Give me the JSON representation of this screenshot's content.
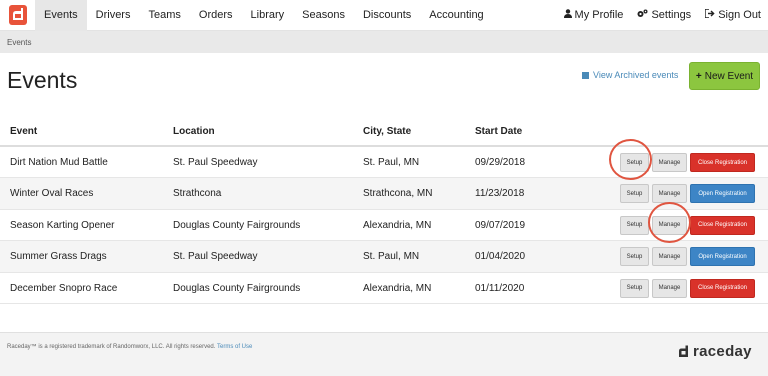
{
  "nav": {
    "items": [
      {
        "label": "Events",
        "active": true
      },
      {
        "label": "Drivers",
        "active": false
      },
      {
        "label": "Teams",
        "active": false
      },
      {
        "label": "Orders",
        "active": false
      },
      {
        "label": "Library",
        "active": false
      },
      {
        "label": "Seasons",
        "active": false
      },
      {
        "label": "Discounts",
        "active": false
      },
      {
        "label": "Accounting",
        "active": false
      }
    ],
    "right": [
      {
        "label": "My Profile",
        "icon": "user-icon"
      },
      {
        "label": "Settings",
        "icon": "gear-icon"
      },
      {
        "label": "Sign Out",
        "icon": "sign-out-icon"
      }
    ]
  },
  "breadcrumb": "Events",
  "page": {
    "title": "Events",
    "archived_link": "View Archived events",
    "new_event_label": "New Event"
  },
  "table": {
    "headers": [
      "Event",
      "Location",
      "City, State",
      "Start Date"
    ],
    "rows": [
      {
        "event": "Dirt Nation Mud Battle",
        "location": "St. Paul Speedway",
        "city": "St. Paul, MN",
        "date": "09/29/2018",
        "setup": "Setup",
        "manage": "Manage",
        "registration": "Close Registration",
        "reg_state": "close"
      },
      {
        "event": "Winter Oval Races",
        "location": "Strathcona",
        "city": "Strathcona, MN",
        "date": "11/23/2018",
        "setup": "Setup",
        "manage": "Manage",
        "registration": "Open Registration",
        "reg_state": "open"
      },
      {
        "event": "Season Karting Opener",
        "location": "Douglas County Fairgrounds",
        "city": "Alexandria, MN",
        "date": "09/07/2019",
        "setup": "Setup",
        "manage": "Manage",
        "registration": "Close Registration",
        "reg_state": "close"
      },
      {
        "event": "Summer Grass Drags",
        "location": "St. Paul Speedway",
        "city": "St. Paul, MN",
        "date": "01/04/2020",
        "setup": "Setup",
        "manage": "Manage",
        "registration": "Open Registration",
        "reg_state": "open"
      },
      {
        "event": "December Snopro Race",
        "location": "Douglas County Fairgrounds",
        "city": "Alexandria, MN",
        "date": "01/11/2020",
        "setup": "Setup",
        "manage": "Manage",
        "registration": "Close Registration",
        "reg_state": "close"
      }
    ]
  },
  "footer": {
    "text": "Raceday™ is a registered trademark of Randomworx, LLC. All rights reserved.",
    "terms_link": "Terms of Use",
    "brand": "raceday"
  },
  "colors": {
    "accent_green": "#8cc63f",
    "close_red": "#d9322a",
    "open_blue": "#3d85c6",
    "logo_orange": "#e8533a",
    "annotation_circle": "#e05540"
  }
}
